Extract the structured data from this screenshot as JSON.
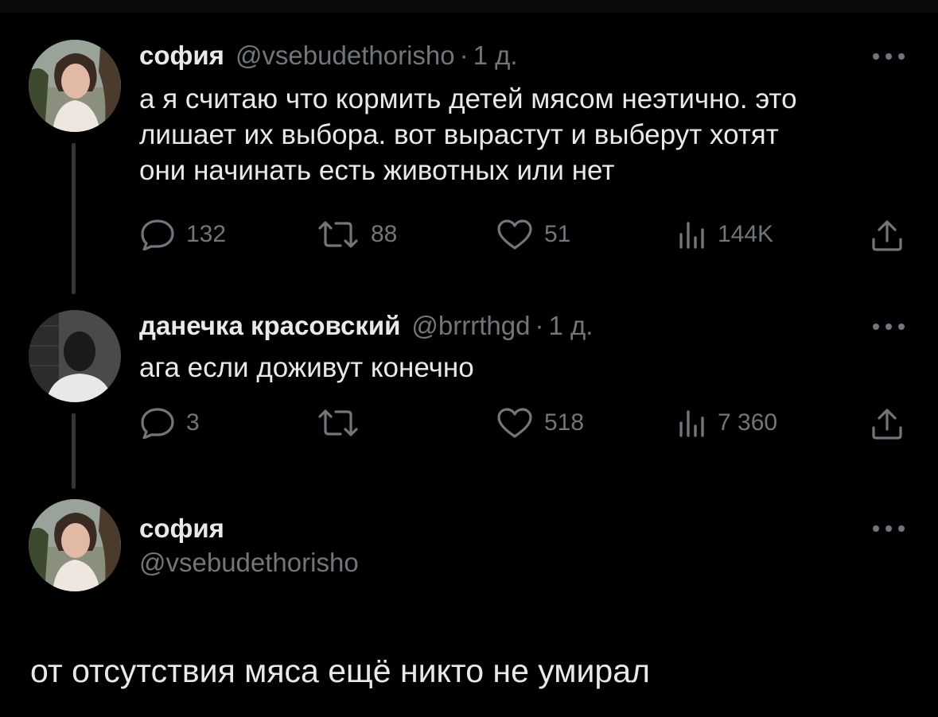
{
  "tweet1": {
    "display_name": "софия",
    "handle": "@vsebudethorisho",
    "dot": "·",
    "time": "1 д.",
    "lines": [
      "а я считаю что кормить детей мясом неэтично. это",
      "лишает их выбора. вот вырастут и выберут хотят",
      "они начинать есть животных или нет"
    ],
    "replies": "132",
    "retweets": "88",
    "likes": "51",
    "views": "144K"
  },
  "tweet2": {
    "display_name": "данечка красовский",
    "handle": "@brrrthgd",
    "dot": "·",
    "time": "1 д.",
    "lines": [
      "ага если доживут конечно"
    ],
    "replies": "3",
    "likes": "518",
    "views": "7 360"
  },
  "tweet3": {
    "display_name": "софия",
    "handle": "@vsebudethorisho",
    "text": "от отсутствия мяса ещё никто не умирал"
  },
  "icons": {
    "reply": "reply-icon",
    "retweet": "retweet-icon",
    "like": "heart-icon",
    "views": "views-icon",
    "share": "share-icon",
    "more": "more-icon"
  },
  "colors": {
    "background": "#000000",
    "text": "#e7e9ea",
    "muted": "#71767b",
    "thread_line": "#333639"
  }
}
